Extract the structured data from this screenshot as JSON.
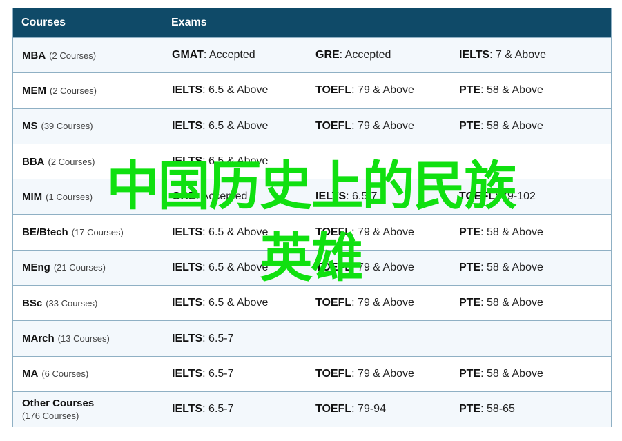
{
  "header": {
    "courses": "Courses",
    "exams": "Exams"
  },
  "rows": [
    {
      "name": "MBA",
      "count": "(2 Courses)",
      "exams": [
        {
          "test": "GMAT",
          "score": ": Accepted"
        },
        {
          "test": "GRE",
          "score": ": Accepted"
        },
        {
          "test": "IELTS",
          "score": ": 7 & Above"
        }
      ]
    },
    {
      "name": "MEM",
      "count": "(2 Courses)",
      "exams": [
        {
          "test": "IELTS",
          "score": ": 6.5 & Above"
        },
        {
          "test": "TOEFL",
          "score": ": 79 & Above"
        },
        {
          "test": "PTE",
          "score": ": 58 & Above"
        }
      ]
    },
    {
      "name": "MS",
      "count": "(39 Courses)",
      "exams": [
        {
          "test": "IELTS",
          "score": ": 6.5 & Above"
        },
        {
          "test": "TOEFL",
          "score": ": 79 & Above"
        },
        {
          "test": "PTE",
          "score": ": 58 & Above"
        }
      ]
    },
    {
      "name": "BBA",
      "count": "(2 Courses)",
      "exams": [
        {
          "test": "IELTS",
          "score": ": 6.5 & Above"
        }
      ]
    },
    {
      "name": "MIM",
      "count": "(1 Courses)",
      "exams": [
        {
          "test": "GRE",
          "score": ": Accepted"
        },
        {
          "test": "IELTS",
          "score": ": 6.5-7"
        },
        {
          "test": "TOEFL",
          "score": ": 79-102"
        }
      ]
    },
    {
      "name": "BE/Btech",
      "count": "(17 Courses)",
      "exams": [
        {
          "test": "IELTS",
          "score": ": 6.5 & Above"
        },
        {
          "test": "TOEFL",
          "score": ": 79 & Above"
        },
        {
          "test": "PTE",
          "score": ": 58 & Above"
        }
      ]
    },
    {
      "name": "MEng",
      "count": "(21 Courses)",
      "exams": [
        {
          "test": "IELTS",
          "score": ": 6.5 & Above"
        },
        {
          "test": "TOEFL",
          "score": ": 79 & Above"
        },
        {
          "test": "PTE",
          "score": ": 58 & Above"
        }
      ]
    },
    {
      "name": "BSc",
      "count": "(33 Courses)",
      "exams": [
        {
          "test": "IELTS",
          "score": ": 6.5 & Above"
        },
        {
          "test": "TOEFL",
          "score": ": 79 & Above"
        },
        {
          "test": "PTE",
          "score": ": 58 & Above"
        }
      ]
    },
    {
      "name": "MArch",
      "count": "(13 Courses)",
      "exams": [
        {
          "test": "IELTS",
          "score": ": 6.5-7"
        }
      ]
    },
    {
      "name": "MA",
      "count": "(6 Courses)",
      "exams": [
        {
          "test": "IELTS",
          "score": ": 6.5-7"
        },
        {
          "test": "TOEFL",
          "score": ": 79 & Above"
        },
        {
          "test": "PTE",
          "score": ": 58 & Above"
        }
      ]
    },
    {
      "name": "Other Courses",
      "count": "(176 Courses)",
      "two_line": true,
      "exams": [
        {
          "test": "IELTS",
          "score": ": 6.5-7"
        },
        {
          "test": "TOEFL",
          "score": ": 79-94"
        },
        {
          "test": "PTE",
          "score": ": 58-65"
        }
      ]
    }
  ],
  "watermark": {
    "line1": "中国历史上的民族",
    "line2": "英雄"
  },
  "colors": {
    "header_bg": "#0f4a68",
    "border": "#8fb0c4",
    "watermark": "#10e010"
  }
}
